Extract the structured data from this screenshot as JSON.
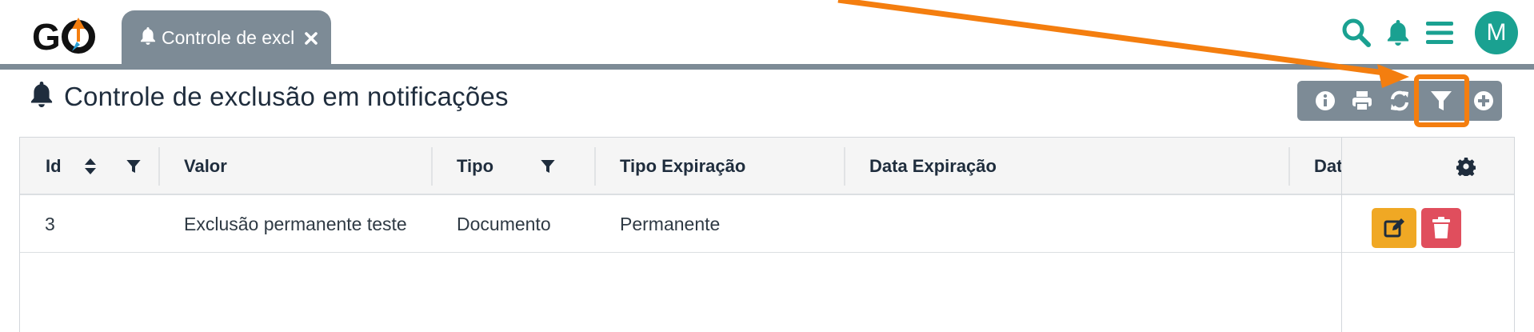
{
  "app": {
    "logo_text": "GO"
  },
  "tab": {
    "label": "Controle de excl",
    "close_symbol": "✕"
  },
  "header_icons": [
    "search-icon",
    "bell-icon",
    "menu-icon"
  ],
  "user": {
    "avatar_letter": "M"
  },
  "page": {
    "title": "Controle de exclusão em notificações"
  },
  "toolbar": {
    "buttons": [
      "info-icon",
      "print-icon",
      "refresh-icon",
      "filter-icon",
      "add-icon"
    ],
    "highlighted": "filter-icon"
  },
  "table": {
    "columns": [
      "Id",
      "Valor",
      "Tipo",
      "Tipo Expiração",
      "Data Expiração",
      "Dat"
    ],
    "rows": [
      {
        "id": "3",
        "valor": "Exclusão permanente teste",
        "tipo": "Documento",
        "tipo_expiracao": "Permanente",
        "data_expiracao": ""
      }
    ]
  },
  "colors": {
    "accent": "#1aa191",
    "bar": "#7d8b96",
    "highlight": "#f47e0f",
    "edit": "#f0a824",
    "delete": "#e04e5d"
  }
}
